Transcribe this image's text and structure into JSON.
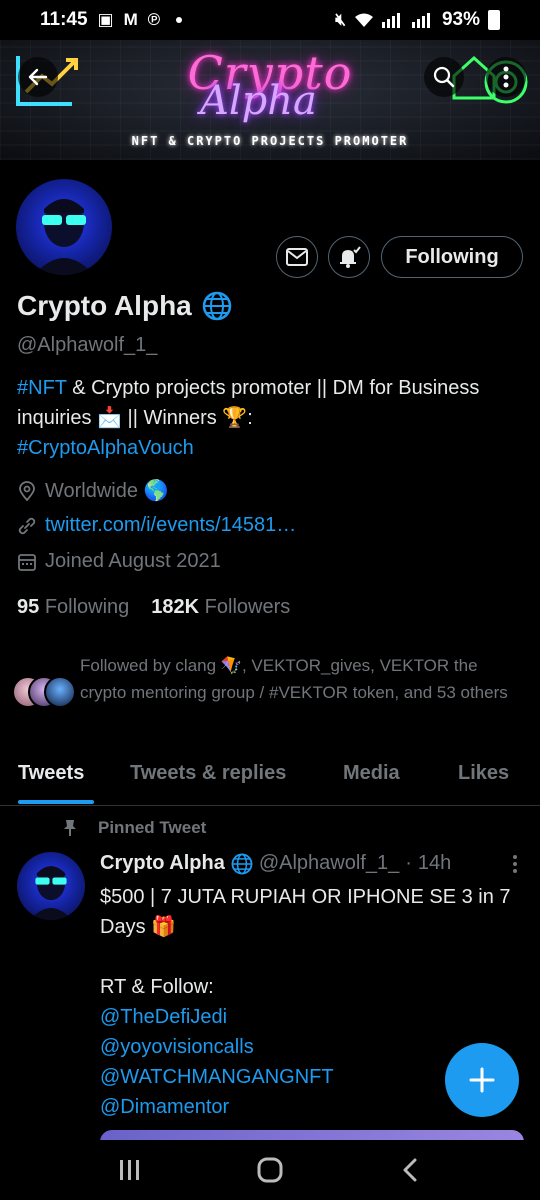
{
  "status_bar": {
    "time": "11:45",
    "battery": "93%"
  },
  "banner": {
    "title_line1": "Crypto",
    "title_line2": "Alpha",
    "subtitle": "NFT & CRYPTO PROJECTS PROMOTER"
  },
  "header_actions": {
    "following_label": "Following"
  },
  "profile": {
    "name": "Crypto Alpha",
    "handle": "@Alphawolf_1_",
    "bio": {
      "hashtag1": "#NFT",
      "text1": " & Crypto projects promoter || DM for Business inquiries 📩 || Winners 🏆:",
      "hashtag2": "#CryptoAlphaVouch"
    },
    "location": "Worldwide 🌎",
    "website": "twitter.com/i/events/14581…",
    "joined": "Joined August 2021",
    "following_count": "95",
    "following_label": "Following",
    "followers_count": "182K",
    "followers_label": "Followers",
    "followed_by": "Followed by clang 🪁, VEKTOR_gives, VEKTOR the crypto mentoring group / #VEKTOR token, and 53 others"
  },
  "tabs": {
    "tweets": "Tweets",
    "replies": "Tweets & replies",
    "media": "Media",
    "likes": "Likes"
  },
  "tweet": {
    "pinned_label": "Pinned Tweet",
    "name": "Crypto Alpha",
    "handle": "@Alphawolf_1_",
    "dot": "·",
    "time": "14h",
    "text": "$500 | 7 JUTA RUPIAH OR IPHONE SE 3 in 7 Days 🎁\n\nRT & Follow:",
    "mentions": [
      "@TheDefiJedi",
      "@yoyovisioncalls",
      "@WATCHMANGANGNFT",
      "@Dimamentor"
    ]
  },
  "colors": {
    "accent": "#1d9bf0",
    "muted": "#71767b",
    "text": "#e7e9ea"
  }
}
